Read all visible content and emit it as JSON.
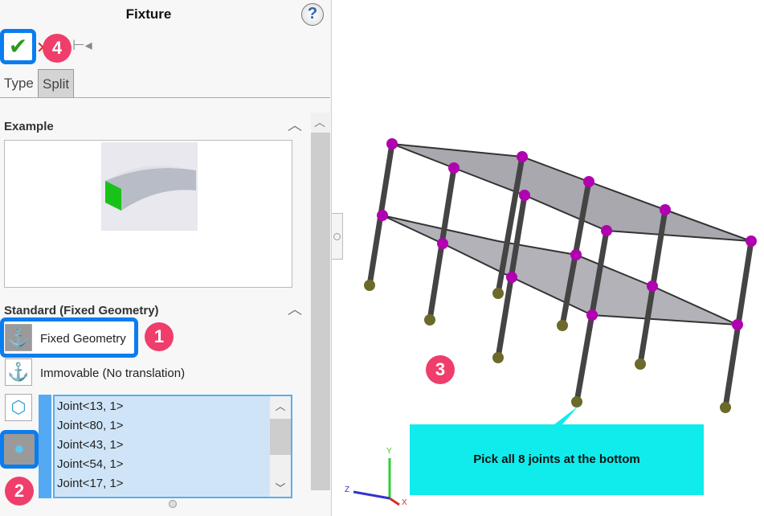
{
  "panel": {
    "title": "Fixture",
    "help": "?",
    "ok_icon": "checkmark-icon",
    "cancel_icon": "x-icon",
    "pin_icon": "pushpin-icon",
    "tabs": [
      {
        "label": "Type",
        "active": true
      },
      {
        "label": "Split",
        "active": false
      }
    ],
    "example": {
      "header": "Example"
    },
    "standard": {
      "header": "Standard (Fixed Geometry)",
      "options": [
        {
          "label": "Fixed Geometry",
          "selected": true
        },
        {
          "label": "Immovable (No translation)",
          "selected": false
        }
      ],
      "joints": [
        "Joint<13, 1>",
        "Joint<80, 1>",
        "Joint<43, 1>",
        "Joint<54, 1>",
        "Joint<17, 1>"
      ]
    }
  },
  "annotations": {
    "b1": "1",
    "b2": "2",
    "b3": "3",
    "b4": "4",
    "callout": "Pick all 8 joints at the bottom"
  },
  "triad": {
    "x": "X",
    "y": "Y",
    "z": "Z"
  },
  "colors": {
    "highlight": "#0a7df0",
    "badge": "#ef3e6b",
    "callout": "#10ecec",
    "joint": "#b000b0"
  }
}
